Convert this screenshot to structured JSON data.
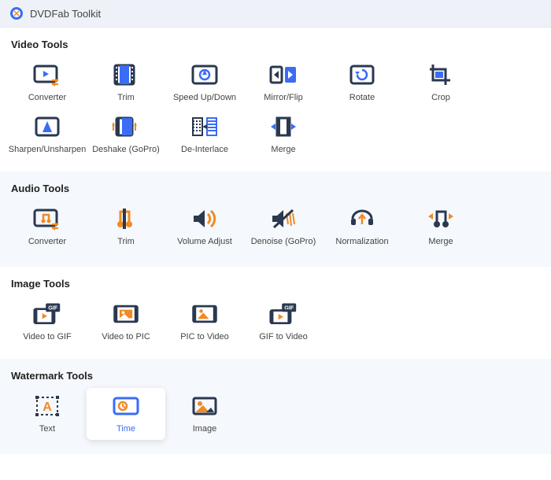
{
  "app": {
    "title": "DVDFab Toolkit"
  },
  "sections": {
    "video": {
      "title": "Video Tools",
      "items": [
        {
          "id": "video-converter",
          "label": "Converter"
        },
        {
          "id": "video-trim",
          "label": "Trim"
        },
        {
          "id": "video-speed",
          "label": "Speed Up/Down"
        },
        {
          "id": "video-mirror",
          "label": "Mirror/Flip"
        },
        {
          "id": "video-rotate",
          "label": "Rotate"
        },
        {
          "id": "video-crop",
          "label": "Crop"
        },
        {
          "id": "video-sharpen",
          "label": "Sharpen/Unsharpen"
        },
        {
          "id": "video-deshake",
          "label": "Deshake (GoPro)"
        },
        {
          "id": "video-deinterlace",
          "label": "De-Interlace"
        },
        {
          "id": "video-merge",
          "label": "Merge"
        }
      ]
    },
    "audio": {
      "title": "Audio Tools",
      "items": [
        {
          "id": "audio-converter",
          "label": "Converter"
        },
        {
          "id": "audio-trim",
          "label": "Trim"
        },
        {
          "id": "audio-volume",
          "label": "Volume Adjust"
        },
        {
          "id": "audio-denoise",
          "label": "Denoise (GoPro)"
        },
        {
          "id": "audio-normalize",
          "label": "Normalization"
        },
        {
          "id": "audio-merge",
          "label": "Merge"
        }
      ]
    },
    "image": {
      "title": "Image Tools",
      "items": [
        {
          "id": "video-to-gif",
          "label": "Video to GIF"
        },
        {
          "id": "video-to-pic",
          "label": "Video to PIC"
        },
        {
          "id": "pic-to-video",
          "label": "PIC to Video"
        },
        {
          "id": "gif-to-video",
          "label": "GIF to Video"
        }
      ]
    },
    "watermark": {
      "title": "Watermark Tools",
      "items": [
        {
          "id": "wm-text",
          "label": "Text"
        },
        {
          "id": "wm-time",
          "label": "Time",
          "selected": true
        },
        {
          "id": "wm-image",
          "label": "Image"
        }
      ]
    }
  },
  "colors": {
    "accent": "#3a6cf5",
    "orange": "#f08a24",
    "dark": "#2a3850"
  }
}
